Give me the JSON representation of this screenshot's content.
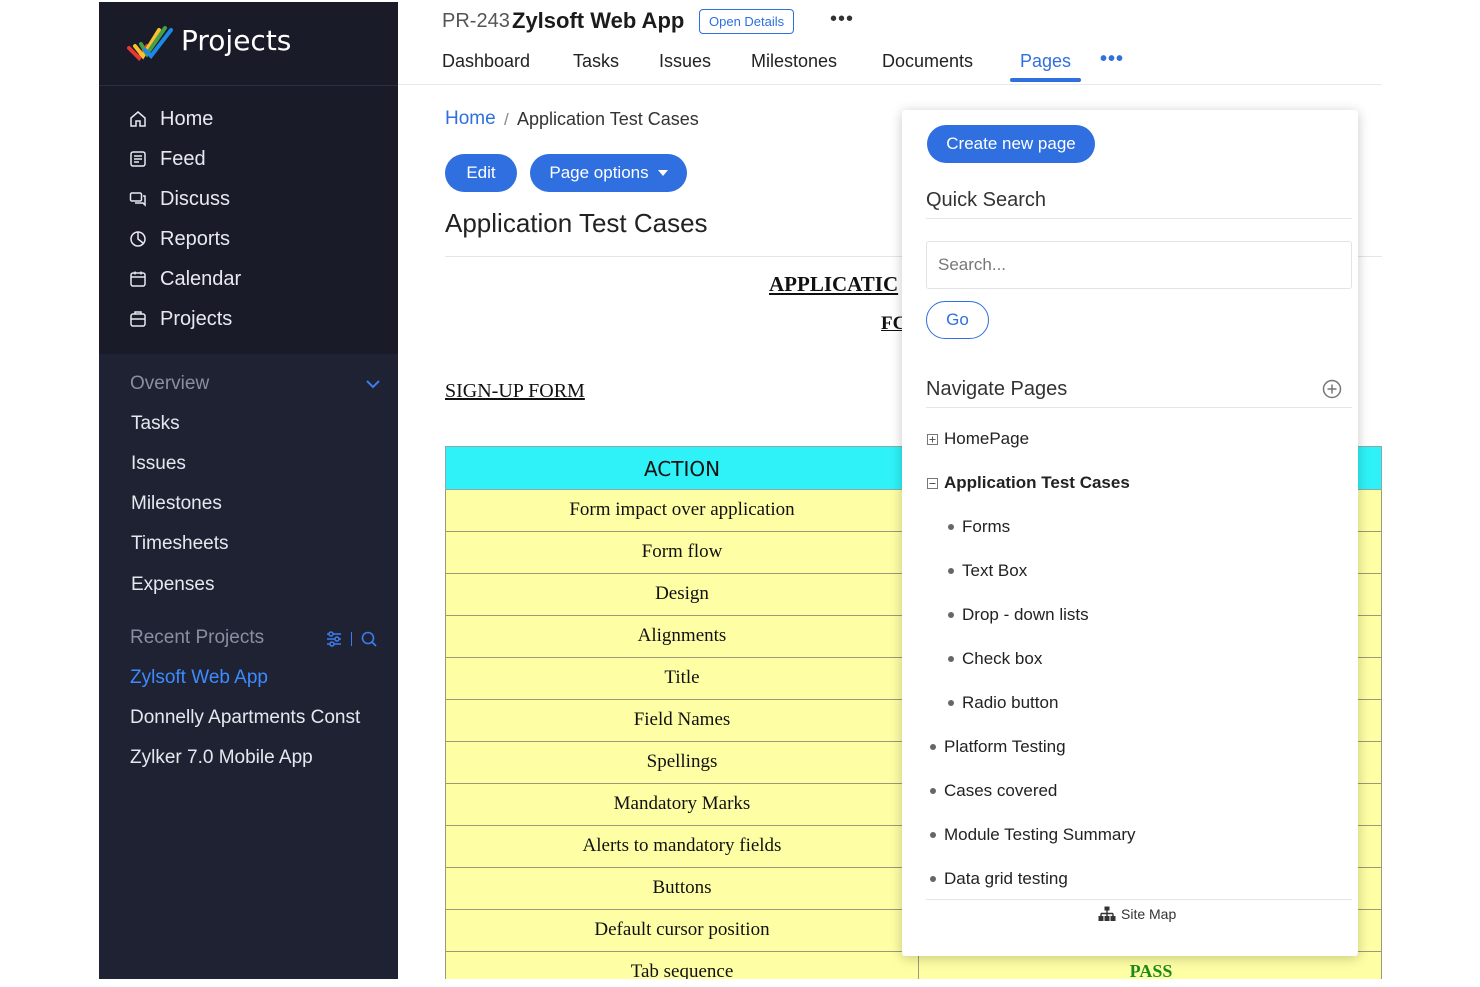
{
  "sidebar": {
    "brand": "Projects",
    "nav": [
      {
        "label": "Home",
        "icon": "home-icon"
      },
      {
        "label": "Feed",
        "icon": "feed-icon"
      },
      {
        "label": "Discuss",
        "icon": "discuss-icon"
      },
      {
        "label": "Reports",
        "icon": "reports-icon"
      },
      {
        "label": "Calendar",
        "icon": "calendar-icon"
      },
      {
        "label": "Projects",
        "icon": "projects-icon"
      }
    ],
    "overview_title": "Overview",
    "overview_items": [
      "Tasks",
      "Issues",
      "Milestones",
      "Timesheets",
      "Expenses"
    ],
    "recent_title": "Recent Projects",
    "recent_items": [
      "Zylsoft Web App",
      "Donnelly Apartments Const",
      "Zylker 7.0 Mobile App"
    ]
  },
  "header": {
    "project_code": "PR-243",
    "project_name": "Zylsoft Web App",
    "open_details": "Open Details",
    "more": "•••",
    "tabs": [
      "Dashboard",
      "Tasks",
      "Issues",
      "Milestones",
      "Documents",
      "Pages"
    ],
    "active_tab": "Pages",
    "tabs_more": "•••"
  },
  "content": {
    "breadcrumb_home": "Home",
    "breadcrumb_sep": "/",
    "breadcrumb_current": "Application Test Cases",
    "edit_label": "Edit",
    "page_options_label": "Page options",
    "page_title": "Application Test Cases",
    "doc_heading_1": "APPLICATIC",
    "doc_heading_2": "FC",
    "signup_heading": "SIGN-UP FORM",
    "table_header": "ACTION",
    "table_rows": [
      "Form impact over application",
      "Form flow",
      "Design",
      "Alignments",
      "Title",
      "Field Names",
      "Spellings",
      "Mandatory Marks",
      "Alerts to mandatory fields",
      "Buttons",
      "Default cursor position",
      "Tab sequence"
    ],
    "last_row_status": "PASS"
  },
  "panel": {
    "create_label": "Create new page",
    "quick_search_title": "Quick Search",
    "search_placeholder": "Search...",
    "go_label": "Go",
    "navigate_title": "Navigate Pages",
    "tree": [
      {
        "label": "HomePage",
        "kind": "expand"
      },
      {
        "label": "Application Test Cases",
        "kind": "collapse"
      },
      {
        "label": "Forms",
        "kind": "child"
      },
      {
        "label": "Text Box",
        "kind": "child"
      },
      {
        "label": "Drop - down lists",
        "kind": "child"
      },
      {
        "label": "Check box",
        "kind": "child"
      },
      {
        "label": "Radio button",
        "kind": "child"
      },
      {
        "label": "Platform Testing",
        "kind": "root"
      },
      {
        "label": "Cases covered",
        "kind": "root"
      },
      {
        "label": "Module Testing Summary",
        "kind": "root"
      },
      {
        "label": "Data grid testing",
        "kind": "root"
      }
    ],
    "sitemap_label": "Site Map"
  },
  "colors": {
    "accent": "#2f6fe0",
    "sidebar_bg": "#1f2233",
    "table_header_bg": "#2ef2f7",
    "table_row_bg": "#fefea4",
    "pass_color": "#1e8a1e"
  }
}
